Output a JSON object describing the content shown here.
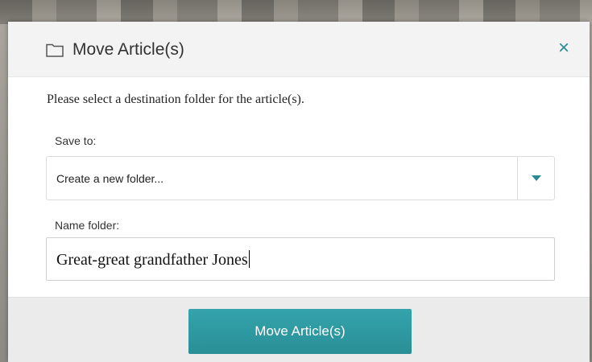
{
  "dialog": {
    "title": "Move Article(s)",
    "close_label": "×",
    "instruction": "Please select a destination folder for the article(s)."
  },
  "save_to": {
    "label": "Save to:",
    "selected": "Create a new folder..."
  },
  "name_folder": {
    "label": "Name folder:",
    "value": "Great-great grandfather Jones"
  },
  "footer": {
    "move_button_label": "Move Article(s)"
  },
  "colors": {
    "accent": "#2a8a94",
    "button": "#2f9aa2"
  },
  "icons": {
    "header": "folder-icon",
    "close": "close-icon",
    "dropdown": "chevron-down-icon"
  }
}
